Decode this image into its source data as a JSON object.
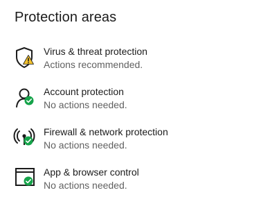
{
  "section": {
    "title": "Protection areas"
  },
  "areas": [
    {
      "label": "Virus & threat protection",
      "status": "Actions recommended.",
      "icon": "shield-icon",
      "badge": "warning",
      "badge_color": "#f2c12e"
    },
    {
      "label": "Account protection",
      "status": "No actions needed.",
      "icon": "person-icon",
      "badge": "ok",
      "badge_color": "#16a34a"
    },
    {
      "label": "Firewall & network protection",
      "status": "No actions needed.",
      "icon": "wireless-icon",
      "badge": "ok",
      "badge_color": "#16a34a"
    },
    {
      "label": "App & browser control",
      "status": "No actions needed.",
      "icon": "browser-window-icon",
      "badge": "ok",
      "badge_color": "#16a34a"
    }
  ]
}
